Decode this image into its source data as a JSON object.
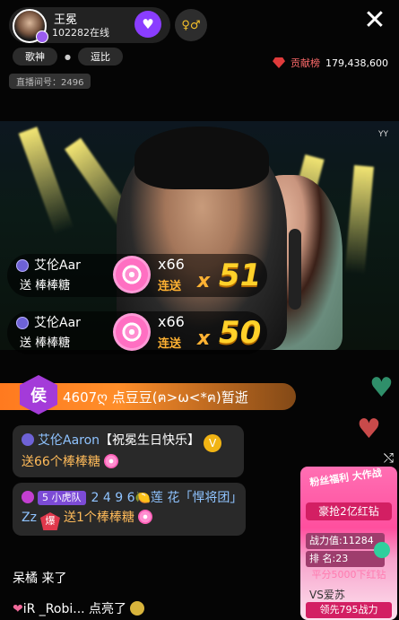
{
  "header": {
    "anchor_name": "王冕",
    "online_count": "102282在线",
    "tags": [
      "歌神",
      "逗比"
    ],
    "room_id": "直播间号：2496",
    "rank_label": "贡献榜",
    "rank_value": "179,438,600",
    "close_icon": "close-icon",
    "video_watermark": "YY"
  },
  "combos": [
    {
      "user": "艾伦Aar",
      "send": "送 棒棒糖",
      "count": "x66",
      "lian": "连送",
      "x": "x",
      "num": "51"
    },
    {
      "user": "艾伦Aar",
      "send": "送 棒棒糖",
      "count": "x66",
      "lian": "连送",
      "x": "x",
      "num": "50"
    }
  ],
  "banner": {
    "badge": "侯",
    "text": "4607ღ 点豆豆(ฅ>ω<*ฅ)暂逝"
  },
  "chat": {
    "msg1": {
      "user": "艾伦Aaron",
      "bless": "【祝冕生日快乐】",
      "gift": "送66个棒棒糖"
    },
    "msg2": {
      "tiger": "5 小虎队",
      "user": "2 4 9 6🍋莲 花「悍将团」Zz",
      "fan": "爆",
      "gift": "送1个棒棒糖"
    },
    "msg3": "呆橘 来了",
    "msg4": {
      "user": "iR _Robi...",
      "action": "点亮了"
    }
  },
  "promo": {
    "title": "粉丝福利 大作战",
    "grab": "豪抢2亿红钻",
    "power": "战力值:11284",
    "rank": "排 名:23",
    "score": "平分5000下红钻",
    "vs": "VS爱苏",
    "lead": "领先795战力"
  }
}
